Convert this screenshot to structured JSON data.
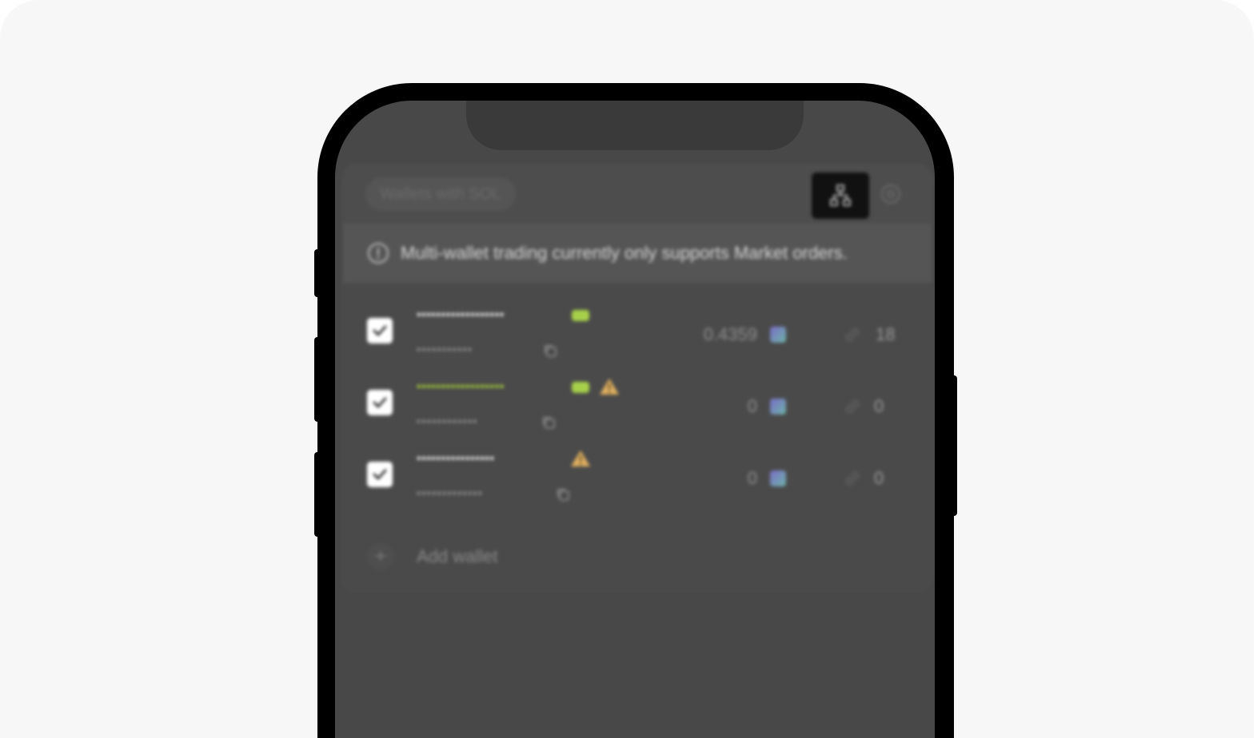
{
  "header": {
    "filter_chip": "Wallets with SOL"
  },
  "notice": {
    "text": "Multi-wallet trading currently only supports Market orders."
  },
  "wallets": [
    {
      "name": "••••••••••••••••••",
      "address": "•••••••••••",
      "balance": "0.4359",
      "count": "18",
      "checked": true,
      "has_tag": true,
      "has_warning": false
    },
    {
      "name": "••••••••••••••••••",
      "address": "••••••••••••",
      "balance": "0",
      "count": "0",
      "checked": true,
      "has_tag": true,
      "has_warning": true
    },
    {
      "name": "••••••••••••••••",
      "address": "•••••••••••••",
      "balance": "0",
      "count": "0",
      "checked": true,
      "has_tag": false,
      "has_warning": true
    }
  ],
  "add_wallet": {
    "label": "Add wallet"
  },
  "colors": {
    "accent_green": "#a6cf3a",
    "warning": "#e0b060",
    "panel": "#4a4a4a"
  },
  "icons": [
    "tree-icon",
    "gear-icon",
    "info-icon",
    "check-icon",
    "copy-icon",
    "warning-icon",
    "sol-token-icon",
    "link-icon",
    "plus-icon"
  ]
}
